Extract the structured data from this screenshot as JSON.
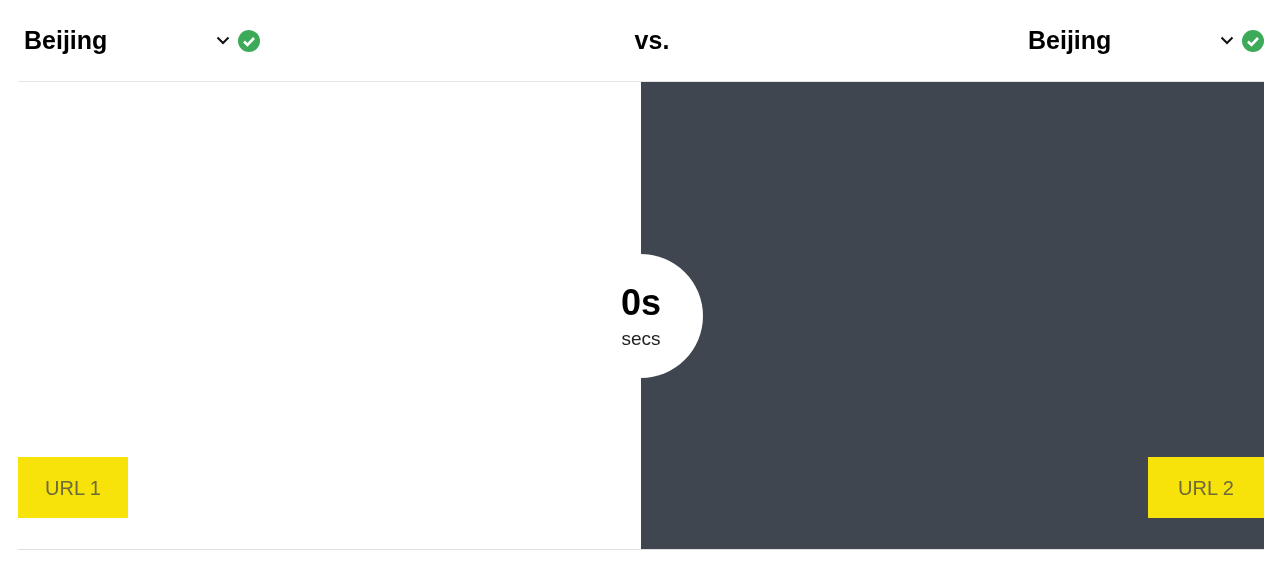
{
  "selectors": [
    {
      "city": "Beijing",
      "verified": true
    },
    {
      "city": "Beijing",
      "verified": true
    }
  ],
  "separator": "vs.",
  "timer": {
    "value": "0s",
    "unit": "secs"
  },
  "panels": [
    {
      "label": "URL 1",
      "color": "#ffffff"
    },
    {
      "label": "URL 2",
      "color": "#3f464f"
    }
  ]
}
